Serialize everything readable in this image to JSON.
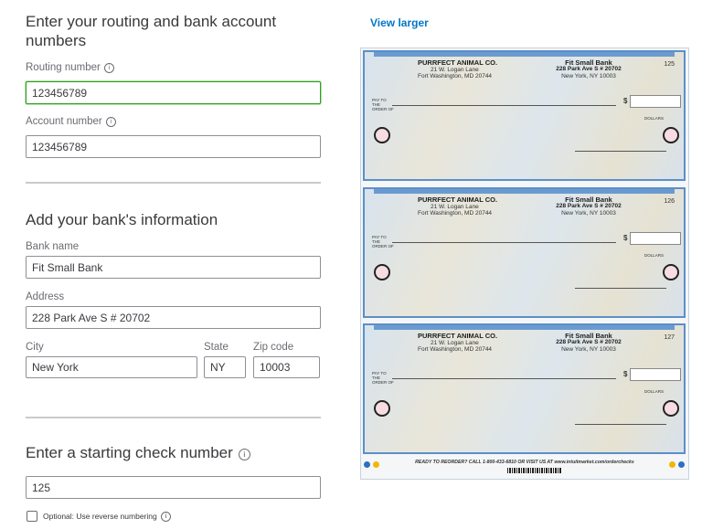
{
  "form": {
    "routing_title": "Enter your routing and bank account numbers",
    "routing_label": "Routing number",
    "routing_value": "123456789",
    "account_label": "Account number",
    "account_value": "123456789",
    "bank_title": "Add your bank's information",
    "bank_name_label": "Bank name",
    "bank_name_value": "Fit Small Bank",
    "address_label": "Address",
    "address_value": "228 Park Ave S # 20702",
    "city_label": "City",
    "city_value": "New York",
    "state_label": "State",
    "state_value": "NY",
    "zip_label": "Zip code",
    "zip_value": "10003",
    "start_title": "Enter a starting check number",
    "start_value": "125",
    "reverse_label": "Optional: Use reverse numbering",
    "info_glyph": "i"
  },
  "preview": {
    "view_larger": "View larger",
    "checks": [
      {
        "company": "PURRFECT ANIMAL CO.",
        "company_addr1": "21 W. Logan Lane",
        "company_addr2": "Fort Washington, MD 20744",
        "bank": "Fit Small Bank",
        "bank_addr1": "228 Park Ave S # 20702",
        "bank_addr2": "New York, NY 10003",
        "number": "125"
      },
      {
        "company": "PURRFECT ANIMAL CO.",
        "company_addr1": "21 W. Logan Lane",
        "company_addr2": "Fort Washington, MD 20744",
        "bank": "Fit Small Bank",
        "bank_addr1": "228 Park Ave S # 20702",
        "bank_addr2": "New York, NY 10003",
        "number": "126"
      },
      {
        "company": "PURRFECT ANIMAL CO.",
        "company_addr1": "21 W. Logan Lane",
        "company_addr2": "Fort Washington, MD 20744",
        "bank": "Fit Small Bank",
        "bank_addr1": "228 Park Ave S # 20702",
        "bank_addr2": "New York, NY 10003",
        "number": "127"
      }
    ],
    "pay_to": "PAY TO THE ORDER OF",
    "dollar_sign": "$",
    "dollars": "DOLLARS",
    "footer": "READY TO REORDER? CALL 1-800-433-6810 OR VISIT US AT www.intuitmarket.com/orderchecks"
  },
  "colors": {
    "accent_green": "#2ca01c",
    "link_blue": "#0077c5",
    "check_border": "#5b8fc9"
  }
}
